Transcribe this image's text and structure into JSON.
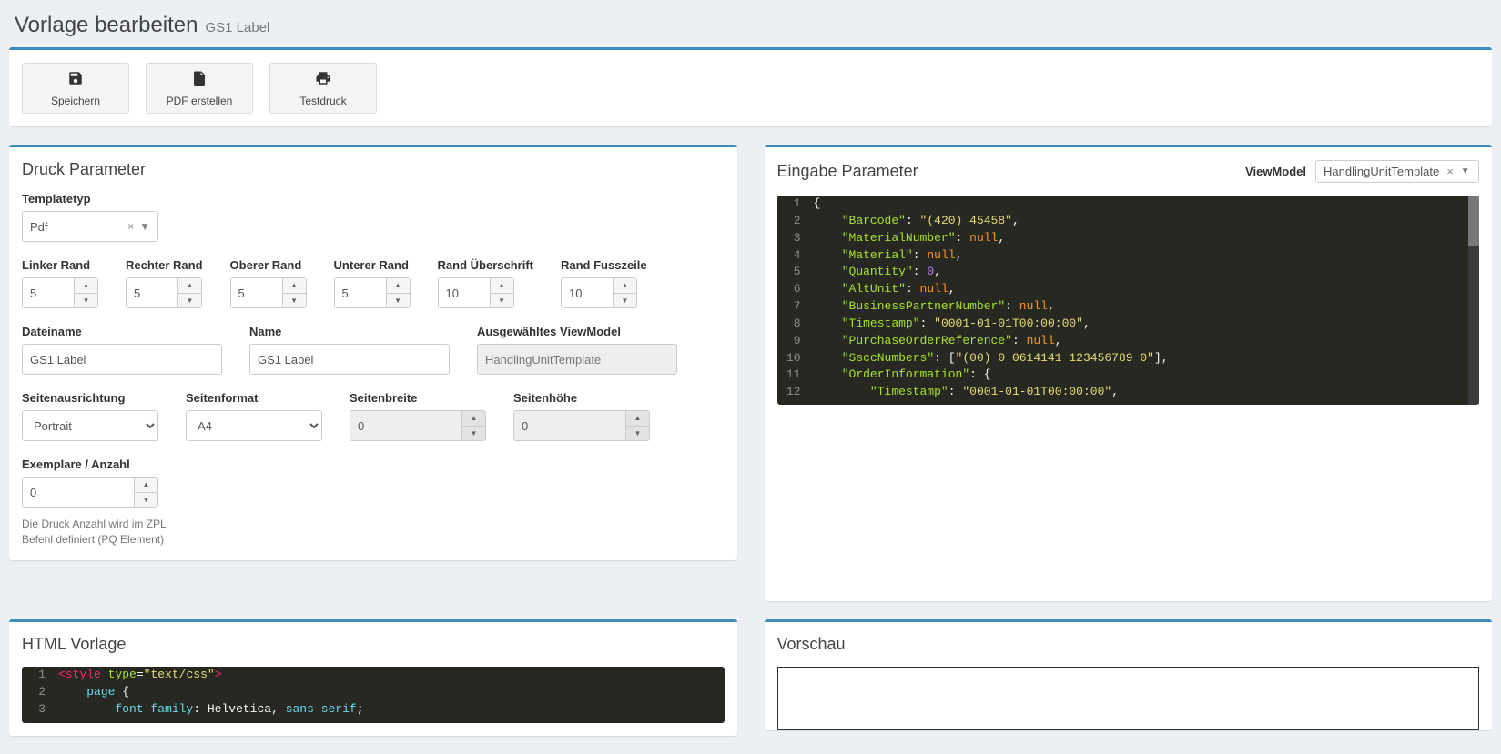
{
  "header": {
    "title": "Vorlage bearbeiten",
    "subtitle": "GS1 Label"
  },
  "toolbar": {
    "save": "Speichern",
    "pdf": "PDF erstellen",
    "testprint": "Testdruck"
  },
  "panels": {
    "druck": "Druck Parameter",
    "eingabe": "Eingabe Parameter",
    "html": "HTML Vorlage",
    "preview": "Vorschau"
  },
  "viewmodel": {
    "label": "ViewModel",
    "value": "HandlingUnitTemplate"
  },
  "form": {
    "templatetyp_label": "Templatetyp",
    "templatetyp_value": "Pdf",
    "linker_rand_label": "Linker Rand",
    "linker_rand_value": "5",
    "rechter_rand_label": "Rechter Rand",
    "rechter_rand_value": "5",
    "oberer_rand_label": "Oberer Rand",
    "oberer_rand_value": "5",
    "unterer_rand_label": "Unterer Rand",
    "unterer_rand_value": "5",
    "rand_ueberschrift_label": "Rand Überschrift",
    "rand_ueberschrift_value": "10",
    "rand_fusszeile_label": "Rand Fusszeile",
    "rand_fusszeile_value": "10",
    "dateiname_label": "Dateiname",
    "dateiname_value": "GS1 Label",
    "name_label": "Name",
    "name_value": "GS1 Label",
    "ausg_viewmodel_label": "Ausgewähltes ViewModel",
    "ausg_viewmodel_value": "HandlingUnitTemplate",
    "seitenausrichtung_label": "Seitenausrichtung",
    "seitenausrichtung_value": "Portrait",
    "seitenformat_label": "Seitenformat",
    "seitenformat_value": "A4",
    "seitenbreite_label": "Seitenbreite",
    "seitenbreite_value": "0",
    "seitenhoehe_label": "Seitenhöhe",
    "seitenhoehe_value": "0",
    "exemplare_label": "Exemplare / Anzahl",
    "exemplare_value": "0",
    "exemplare_hint": "Die Druck Anzahl wird im ZPL Befehl definiert (PQ Element)"
  },
  "json_editor": {
    "lines": [
      {
        "n": "1",
        "parts": [
          {
            "t": "{",
            "c": "punc"
          }
        ]
      },
      {
        "n": "2",
        "parts": [
          {
            "t": "    ",
            "c": "punc"
          },
          {
            "t": "\"Barcode\"",
            "c": "key"
          },
          {
            "t": ": ",
            "c": "punc"
          },
          {
            "t": "\"(420) 45458\"",
            "c": "str"
          },
          {
            "t": ",",
            "c": "punc"
          }
        ]
      },
      {
        "n": "3",
        "parts": [
          {
            "t": "    ",
            "c": "punc"
          },
          {
            "t": "\"MaterialNumber\"",
            "c": "key"
          },
          {
            "t": ": ",
            "c": "punc"
          },
          {
            "t": "null",
            "c": "null"
          },
          {
            "t": ",",
            "c": "punc"
          }
        ]
      },
      {
        "n": "4",
        "parts": [
          {
            "t": "    ",
            "c": "punc"
          },
          {
            "t": "\"Material\"",
            "c": "key"
          },
          {
            "t": ": ",
            "c": "punc"
          },
          {
            "t": "null",
            "c": "null"
          },
          {
            "t": ",",
            "c": "punc"
          }
        ]
      },
      {
        "n": "5",
        "parts": [
          {
            "t": "    ",
            "c": "punc"
          },
          {
            "t": "\"Quantity\"",
            "c": "key"
          },
          {
            "t": ": ",
            "c": "punc"
          },
          {
            "t": "0",
            "c": "num"
          },
          {
            "t": ",",
            "c": "punc"
          }
        ]
      },
      {
        "n": "6",
        "parts": [
          {
            "t": "    ",
            "c": "punc"
          },
          {
            "t": "\"AltUnit\"",
            "c": "key"
          },
          {
            "t": ": ",
            "c": "punc"
          },
          {
            "t": "null",
            "c": "null"
          },
          {
            "t": ",",
            "c": "punc"
          }
        ]
      },
      {
        "n": "7",
        "parts": [
          {
            "t": "    ",
            "c": "punc"
          },
          {
            "t": "\"BusinessPartnerNumber\"",
            "c": "key"
          },
          {
            "t": ": ",
            "c": "punc"
          },
          {
            "t": "null",
            "c": "null"
          },
          {
            "t": ",",
            "c": "punc"
          }
        ]
      },
      {
        "n": "8",
        "parts": [
          {
            "t": "    ",
            "c": "punc"
          },
          {
            "t": "\"Timestamp\"",
            "c": "key"
          },
          {
            "t": ": ",
            "c": "punc"
          },
          {
            "t": "\"0001-01-01T00:00:00\"",
            "c": "str"
          },
          {
            "t": ",",
            "c": "punc"
          }
        ]
      },
      {
        "n": "9",
        "parts": [
          {
            "t": "    ",
            "c": "punc"
          },
          {
            "t": "\"PurchaseOrderReference\"",
            "c": "key"
          },
          {
            "t": ": ",
            "c": "punc"
          },
          {
            "t": "null",
            "c": "null"
          },
          {
            "t": ",",
            "c": "punc"
          }
        ]
      },
      {
        "n": "10",
        "parts": [
          {
            "t": "    ",
            "c": "punc"
          },
          {
            "t": "\"SsccNumbers\"",
            "c": "key"
          },
          {
            "t": ": [",
            "c": "punc"
          },
          {
            "t": "\"(00) 0 0614141 123456789 0\"",
            "c": "str"
          },
          {
            "t": "],",
            "c": "punc"
          }
        ]
      },
      {
        "n": "11",
        "parts": [
          {
            "t": "    ",
            "c": "punc"
          },
          {
            "t": "\"OrderInformation\"",
            "c": "key"
          },
          {
            "t": ": {",
            "c": "punc"
          }
        ]
      },
      {
        "n": "12",
        "parts": [
          {
            "t": "        ",
            "c": "punc"
          },
          {
            "t": "\"Timestamp\"",
            "c": "key"
          },
          {
            "t": ": ",
            "c": "punc"
          },
          {
            "t": "\"0001-01-01T00:00:00\"",
            "c": "str"
          },
          {
            "t": ",",
            "c": "punc"
          }
        ]
      }
    ]
  },
  "html_editor": {
    "lines": [
      {
        "n": "1",
        "parts": [
          {
            "t": "<",
            "c": "tag"
          },
          {
            "t": "style",
            "c": "tag"
          },
          {
            "t": " ",
            "c": "punc"
          },
          {
            "t": "type",
            "c": "attr"
          },
          {
            "t": "=",
            "c": "punc"
          },
          {
            "t": "\"text/css\"",
            "c": "str"
          },
          {
            "t": ">",
            "c": "tag"
          }
        ]
      },
      {
        "n": "2",
        "parts": [
          {
            "t": "    ",
            "c": "punc"
          },
          {
            "t": "page",
            "c": "css-key"
          },
          {
            "t": " {",
            "c": "punc"
          }
        ]
      },
      {
        "n": "3",
        "parts": [
          {
            "t": "        ",
            "c": "punc"
          },
          {
            "t": "font-family",
            "c": "css-key"
          },
          {
            "t": ": ",
            "c": "punc"
          },
          {
            "t": "Helvetica",
            "c": "css-val"
          },
          {
            "t": ", ",
            "c": "punc"
          },
          {
            "t": "sans-serif",
            "c": "css-key"
          },
          {
            "t": ";",
            "c": "punc"
          }
        ]
      }
    ]
  }
}
